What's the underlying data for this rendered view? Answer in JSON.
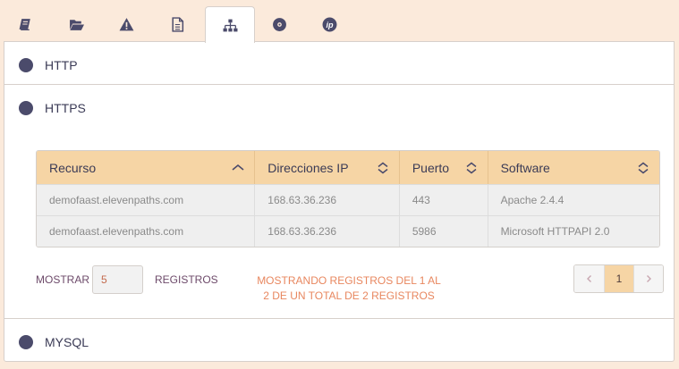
{
  "tabs": [
    {
      "icon": "book-icon",
      "active": false
    },
    {
      "icon": "folder-open-icon",
      "active": false
    },
    {
      "icon": "warning-icon",
      "active": false
    },
    {
      "icon": "document-icon",
      "active": false
    },
    {
      "icon": "sitemap-icon",
      "active": true
    },
    {
      "icon": "disc-icon",
      "active": false
    },
    {
      "icon": "ip-icon",
      "active": false
    }
  ],
  "sections": {
    "http": {
      "label": "HTTP"
    },
    "https": {
      "label": "HTTPS"
    },
    "mysql": {
      "label": "MYSQL"
    }
  },
  "table": {
    "columns": [
      "Recurso",
      "Direcciones IP",
      "Puerto",
      "Software"
    ],
    "rows": [
      [
        "demofaast.elevenpaths.com",
        "168.63.36.236",
        "443",
        "Apache 2.4.4"
      ],
      [
        "demofaast.elevenpaths.com",
        "168.63.36.236",
        "5986",
        "Microsoft HTTPAPI 2.0"
      ]
    ]
  },
  "footer": {
    "show_label": "MOSTRAR",
    "page_size": "5",
    "records_label": "REGISTROS",
    "info_line1": "MOSTRANDO REGISTROS DEL 1 AL",
    "info_line2": "2 DE UN TOTAL DE 2 REGISTROS",
    "current_page": "1"
  },
  "colors": {
    "background": "#fbeadb",
    "header": "#f6d5a5",
    "accent": "#e8875f",
    "dot": "#4b4b6b"
  }
}
